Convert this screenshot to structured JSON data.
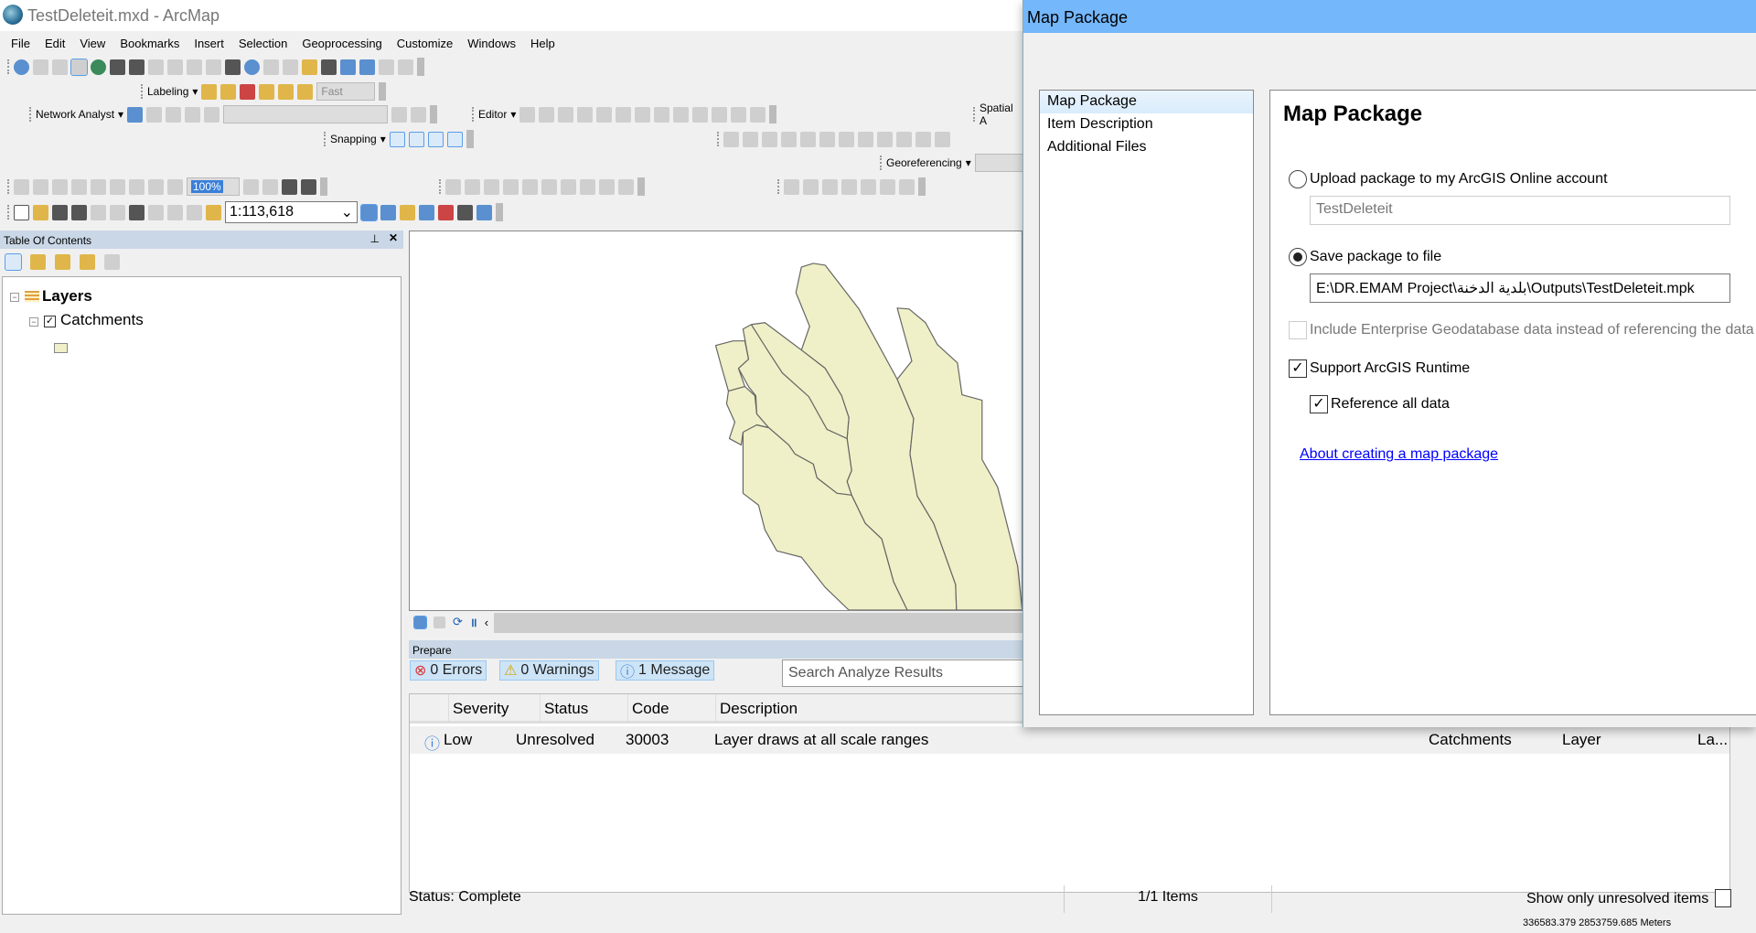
{
  "app": {
    "title": "TestDeleteit.mxd - ArcMap"
  },
  "menu": [
    "File",
    "Edit",
    "View",
    "Bookmarks",
    "Insert",
    "Selection",
    "Geoprocessing",
    "Customize",
    "Windows",
    "Help"
  ],
  "toolbars": {
    "labeling": "Labeling",
    "label_quality": "Fast",
    "network_analyst": "Network Analyst",
    "editor": "Editor",
    "spatial": "Spatial A",
    "snapping": "Snapping",
    "georeferencing": "Georeferencing",
    "zoom_percent": "100%",
    "map_scale": "1:113,618"
  },
  "toc": {
    "title": "Table Of Contents",
    "root": "Layers",
    "layer": "Catchments",
    "layer_checked": true,
    "symbol_color": "#f0f0c8"
  },
  "map": {
    "fill": "#f0f0c8",
    "stroke": "#666666"
  },
  "prepare": {
    "title": "Prepare",
    "errors": "0 Errors",
    "warnings": "0 Warnings",
    "messages": "1 Message",
    "search_placeholder": "Search Analyze Results",
    "columns": [
      "Severity",
      "Status",
      "Code",
      "Description"
    ],
    "rows": [
      {
        "severity": "Low",
        "status": "Unresolved",
        "code": "30003",
        "description": "Layer draws at all scale ranges",
        "name": "Catchments",
        "type": "Layer",
        "extra": "La..."
      }
    ],
    "status": "Status: Complete",
    "items": "1/1 Items",
    "show_unresolved": "Show only unresolved items"
  },
  "statusbar": {
    "coordinates": "336583.379  2853759.685 Meters"
  },
  "dialog": {
    "title": "Map Package",
    "nav": [
      "Map Package",
      "Item Description",
      "Additional Files"
    ],
    "heading": "Map Package",
    "upload_label": "Upload package to my ArcGIS Online account",
    "upload_value": "TestDeleteit",
    "save_label": "Save package to file",
    "save_path": "E:\\DR.EMAM Project\\بلدية الدخنة\\Outputs\\TestDeleteit.mpk",
    "include_egdb": "Include Enterprise Geodatabase data instead of referencing the data",
    "support_runtime": "Support ArcGIS Runtime",
    "reference_all": "Reference all data",
    "help_link": "About creating a map package"
  }
}
